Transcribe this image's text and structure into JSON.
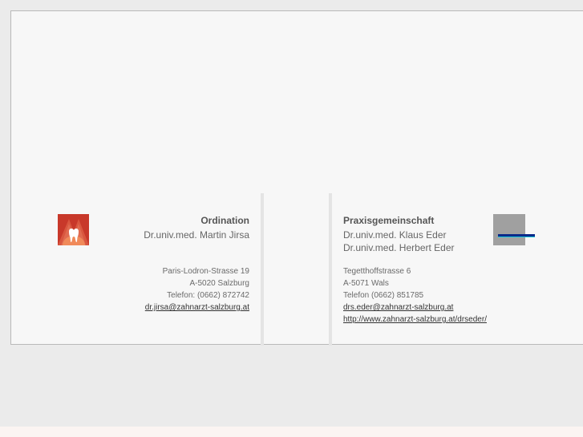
{
  "left": {
    "title": "Ordination",
    "doctor": "Dr.univ.med. Martin Jirsa",
    "street": "Paris-Lodron-Strasse 19",
    "city": "A-5020 Salzburg",
    "phone": "Telefon: (0662) 872742",
    "email": "dr.jirsa@zahnarzt-salzburg.at"
  },
  "right": {
    "title": "Praxisgemeinschaft",
    "doctor1": "Dr.univ.med. Klaus Eder",
    "doctor2": "Dr.univ.med. Herbert Eder",
    "street": "Tegetthoffstrasse 6",
    "city": "A-5071 Wals",
    "phone": "Telefon (0662) 851785",
    "email": "drs.eder@zahnarzt-salzburg.at",
    "website": "http://www.zahnarzt-salzburg.at/drseder/"
  },
  "colors": {
    "logo_left": "#c8382a",
    "logo_right": "#a0a0a0",
    "logo_right_line": "#0a2a8a"
  },
  "icons": {
    "left_logo": "tooth-logo-icon",
    "right_logo": "practice-logo-icon"
  }
}
